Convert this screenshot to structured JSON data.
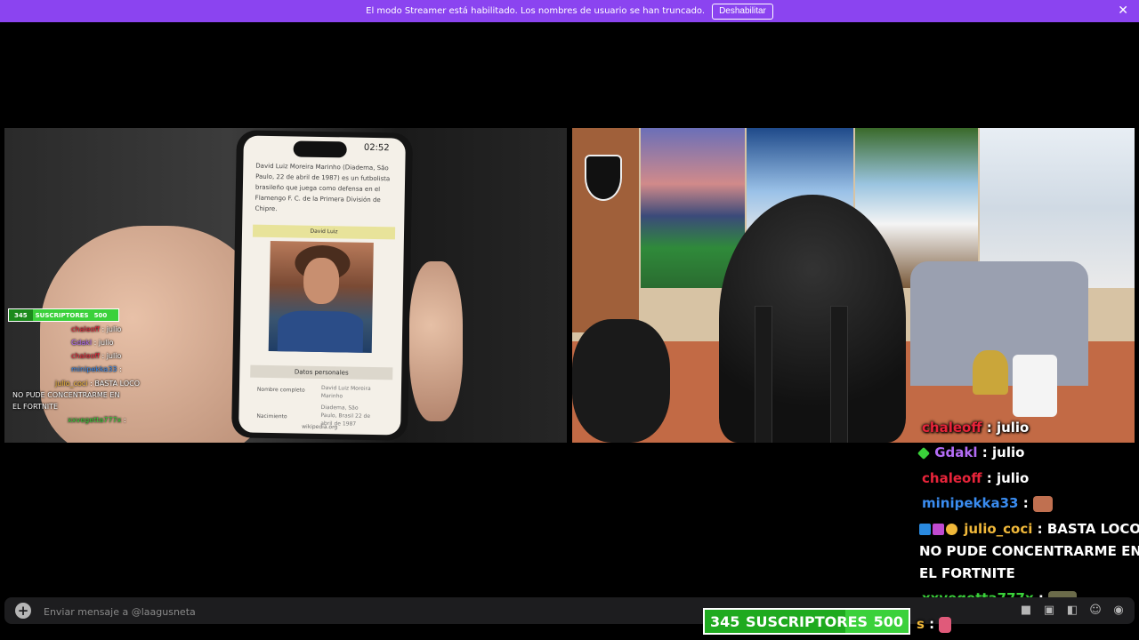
{
  "banner": {
    "text": "El modo Streamer está habilitado. Los nombres de usuario se han truncado.",
    "button_label": "Deshabilitar",
    "close_glyph": "✕"
  },
  "phone": {
    "clock": "02:52",
    "paragraph": "David Luiz Moreira Marinho (Diadema, São Paulo, 22 de abril de 1987) es un futbolista brasileño que juega como defensa en el Flamengo F. C. de la Primera División de Chipre.",
    "infobox_title": "David Luiz",
    "section_title": "Datos personales",
    "row1_label": "Nombre completo",
    "row1_value": "David Luiz Moreira Marinho",
    "row2_label": "Nacimiento",
    "row2_value": "Diadema, São Paulo, Brasil 22 de abril de 1987",
    "url": "wikipedia.org"
  },
  "overlay_small": {
    "sub_left": "345",
    "sub_label": "SUSCRIPTORES",
    "sub_right": "500",
    "lines": [
      {
        "user": "chaleoff",
        "text": ": julio"
      },
      {
        "user": "Gdakl",
        "text": ": julio"
      },
      {
        "user": "chaleoff",
        "text": ": julio"
      },
      {
        "user": "minipekka33",
        "text": ":"
      },
      {
        "user": "julio_coci",
        "text": ": BASTA LOCO"
      },
      {
        "user": "",
        "text": "NO PUDE CONCENTRARME EN"
      },
      {
        "user": "",
        "text": "EL FORTNITE"
      },
      {
        "user": "xxvegetta777x",
        "text": ":"
      }
    ]
  },
  "chat": {
    "colors": {
      "chaleoff": "#e8243a",
      "gdakl": "#b36cf5",
      "minipekka": "#3a8cf0",
      "julio": "#f0b83a",
      "vegetta": "#3ad13a"
    },
    "lines": [
      {
        "user": "chaleoff",
        "msg": "julio"
      },
      {
        "user": "Gdakl",
        "msg": "julio"
      },
      {
        "user": "chaleoff",
        "msg": "julio"
      },
      {
        "user": "minipekka33",
        "msg": ""
      },
      {
        "user": "julio_coci",
        "msg": "BASTA LOCO"
      },
      {
        "user": "",
        "msg": "NO PUDE CONCENTRARME EN"
      },
      {
        "user": "",
        "msg": "EL FORTNITE"
      },
      {
        "user": "xxvegetta777x",
        "msg": ""
      },
      {
        "user": "s",
        "msg": ""
      }
    ],
    "colon": ":"
  },
  "sub_bar": {
    "current": "345",
    "label": "SUSCRIPTORES",
    "goal": "500",
    "progress_fraction": 0.69
  },
  "input": {
    "placeholder": "Enviar mensaje a @laagusneta",
    "plus_glyph": "+"
  },
  "tool_icons": [
    "gift-icon",
    "gif-icon",
    "sticker-icon",
    "emoji-icon",
    "apps-icon"
  ]
}
